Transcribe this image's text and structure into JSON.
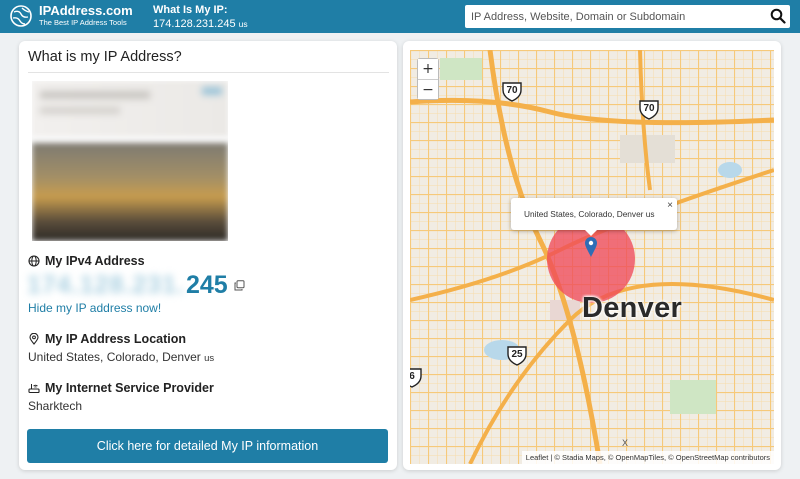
{
  "header": {
    "brand_name": "IPAddress.com",
    "brand_tagline": "The Best IP Address Tools",
    "myip_label": "What Is My IP:",
    "myip_value": "174.128.231.245",
    "myip_country": "us",
    "search_placeholder": "IP Address, Website, Domain or Subdomain"
  },
  "card": {
    "title": "What is my IP Address?",
    "ipv4_heading": "My IPv4 Address",
    "ipv4_blurred": "174.128.231.",
    "ipv4_visible": "245",
    "hide_link": "Hide my IP address now!",
    "location_heading": "My IP Address Location",
    "location_value": "United States, Colorado, Denver",
    "location_country": "us",
    "isp_heading": "My Internet Service Provider",
    "isp_value": "Sharktech",
    "detail_button": "Click here for detailed My IP information"
  },
  "map": {
    "zoom_in": "+",
    "zoom_out": "−",
    "popup_text": "United States, Colorado, Denver us",
    "popup_close": "×",
    "city_label": "Denver",
    "highway_shields": [
      "70",
      "70",
      "25",
      "6"
    ],
    "attribution_leaflet": "Leaflet",
    "attribution_rest": " | © Stadia Maps, © OpenMapTiles, © OpenStreetMap contributors",
    "attribution_x": "X",
    "accent_radius_color": "#f04a5a"
  },
  "colors": {
    "brand": "#1f7ea6",
    "ip_accent": "#1f7ea6"
  }
}
